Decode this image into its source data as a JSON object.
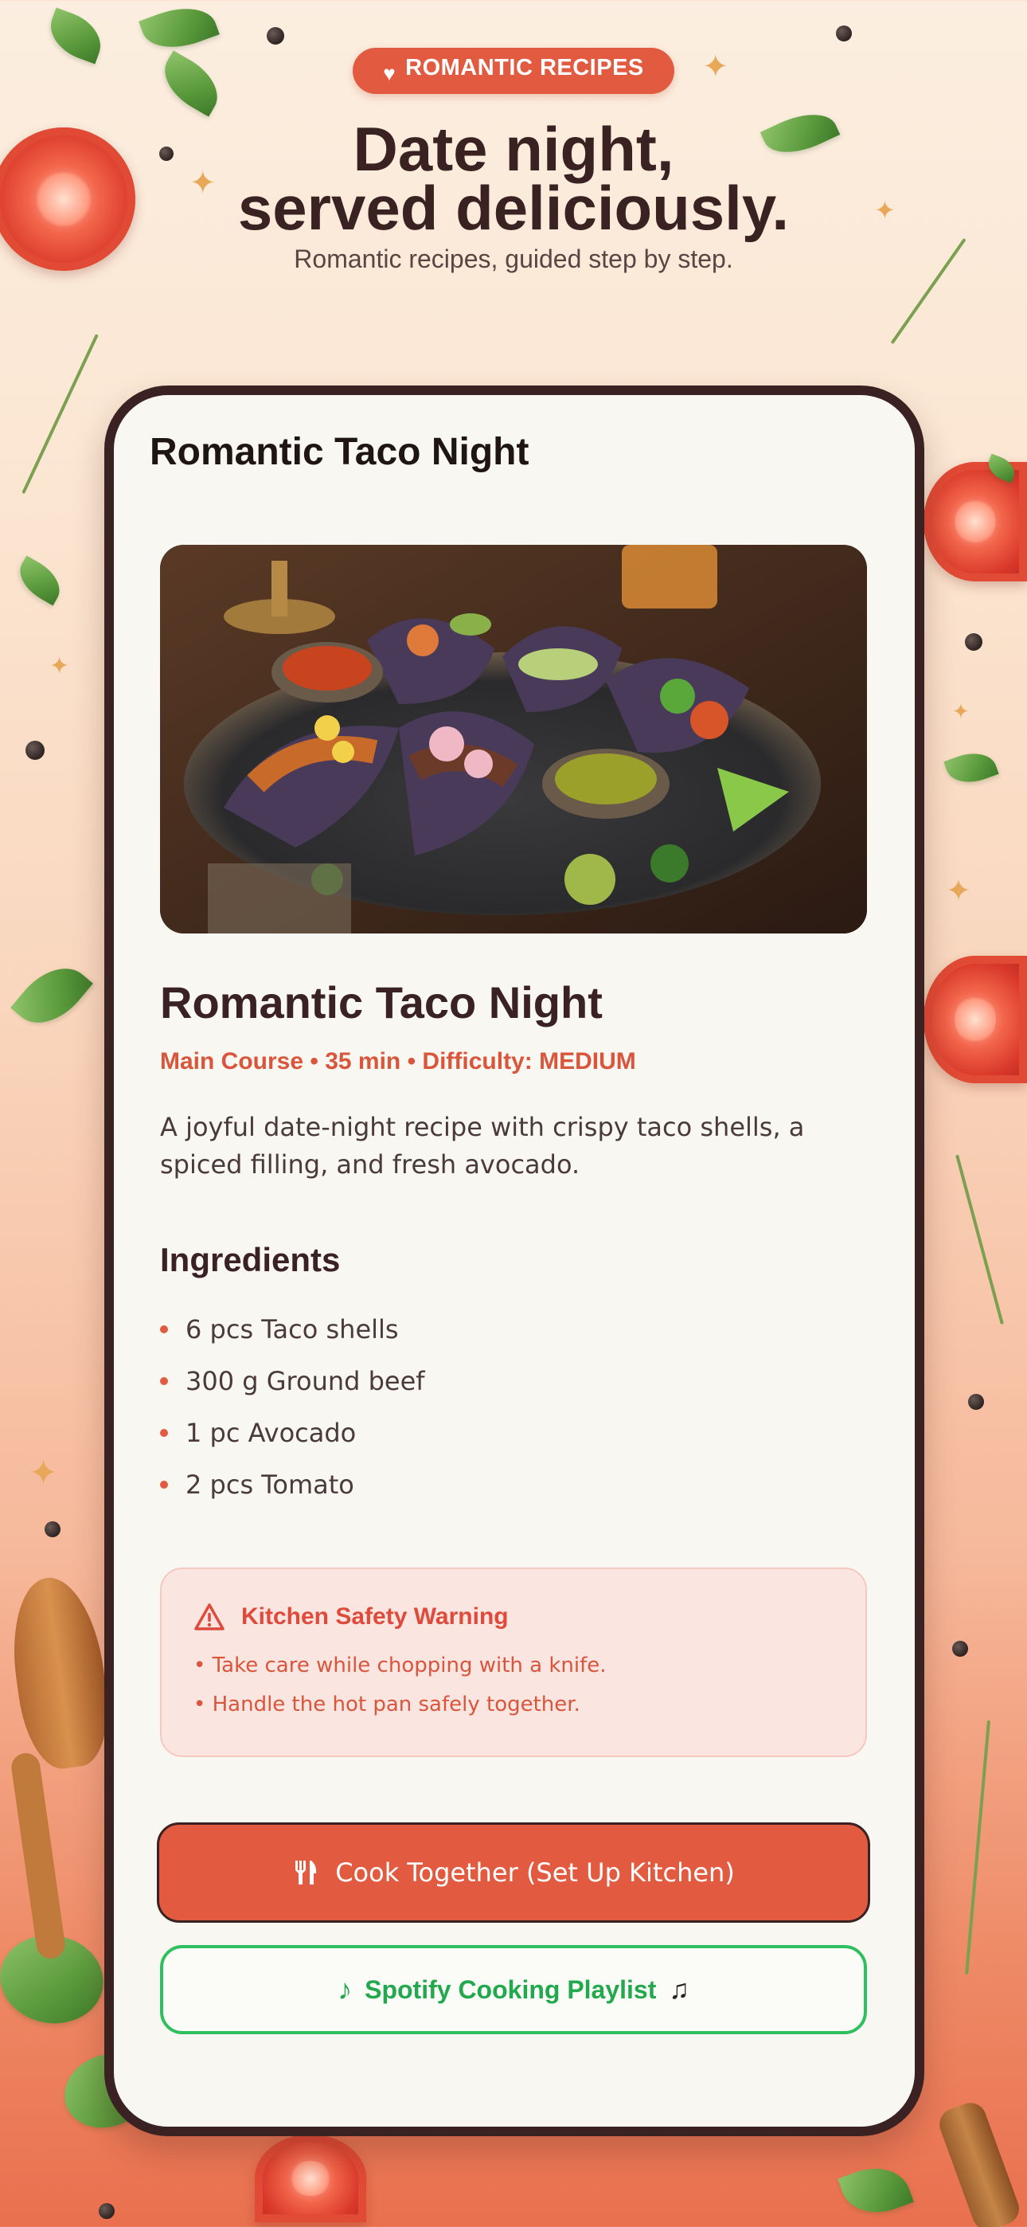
{
  "header": {
    "badge_label": "ROMANTIC RECIPES",
    "title_line1": "Date night,",
    "title_line2": "served deliciously.",
    "subtitle": "Romantic recipes, guided step by step."
  },
  "card": {
    "header_title": "Romantic Taco Night",
    "image_alt": "Plate of tacos with salsa and lime",
    "recipe_title": "Romantic Taco Night",
    "meta": "Main Course • 35 min • Difficulty: MEDIUM",
    "description": "A joyful date-night recipe with crispy taco shells, a spiced filling, and fresh avocado.",
    "ingredients_heading": "Ingredients",
    "ingredients": [
      "6 pcs Taco shells",
      "300 g Ground beef",
      "1 pc Avocado",
      "2 pcs Tomato"
    ],
    "warning": {
      "title": "Kitchen Safety Warning",
      "items": [
        "• Take care while chopping with a knife.",
        "• Handle the hot pan safely together."
      ]
    },
    "buttons": {
      "cook_label": "Cook Together (Set Up Kitchen)",
      "spotify_label": "Spotify Cooking Playlist"
    }
  },
  "colors": {
    "accent": "#e25b41",
    "dark": "#3a2222",
    "spotify_green": "#2fbf5f",
    "warning_bg": "#fbe5e1"
  },
  "icons": {
    "badge": "heart-icon",
    "warning": "warning-triangle-icon",
    "cook": "fork-knife-icon",
    "spotify": "music-note-icon"
  }
}
